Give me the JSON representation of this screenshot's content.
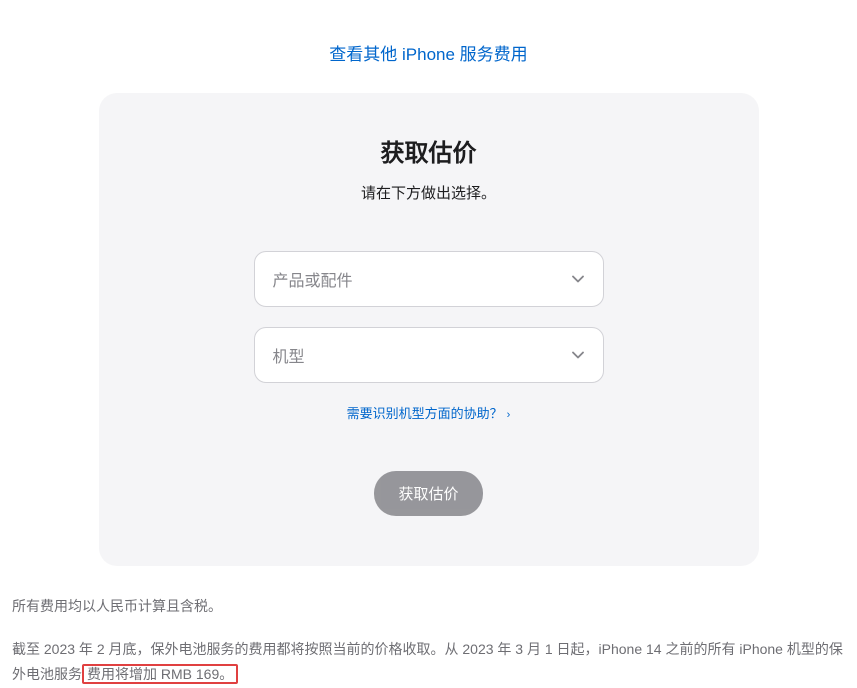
{
  "topLink": {
    "text": "查看其他 iPhone 服务费用"
  },
  "card": {
    "title": "获取估价",
    "subtitle": "请在下方做出选择。",
    "select1": {
      "placeholder": "产品或配件"
    },
    "select2": {
      "placeholder": "机型"
    },
    "helpLink": {
      "text": "需要识别机型方面的协助？"
    },
    "submitButton": {
      "label": "获取估价"
    }
  },
  "footer": {
    "line1": "所有费用均以人民币计算且含税。",
    "line2_part1": "截至 2023 年 2 月底，保外电池服务的费用都将按照当前的价格收取。从 2023 年 3 月 1 日起，iPhone 14 之前的所有 iPhone 机型的保外电池服务",
    "line2_highlight": "费用将增加 RMB 169。"
  }
}
